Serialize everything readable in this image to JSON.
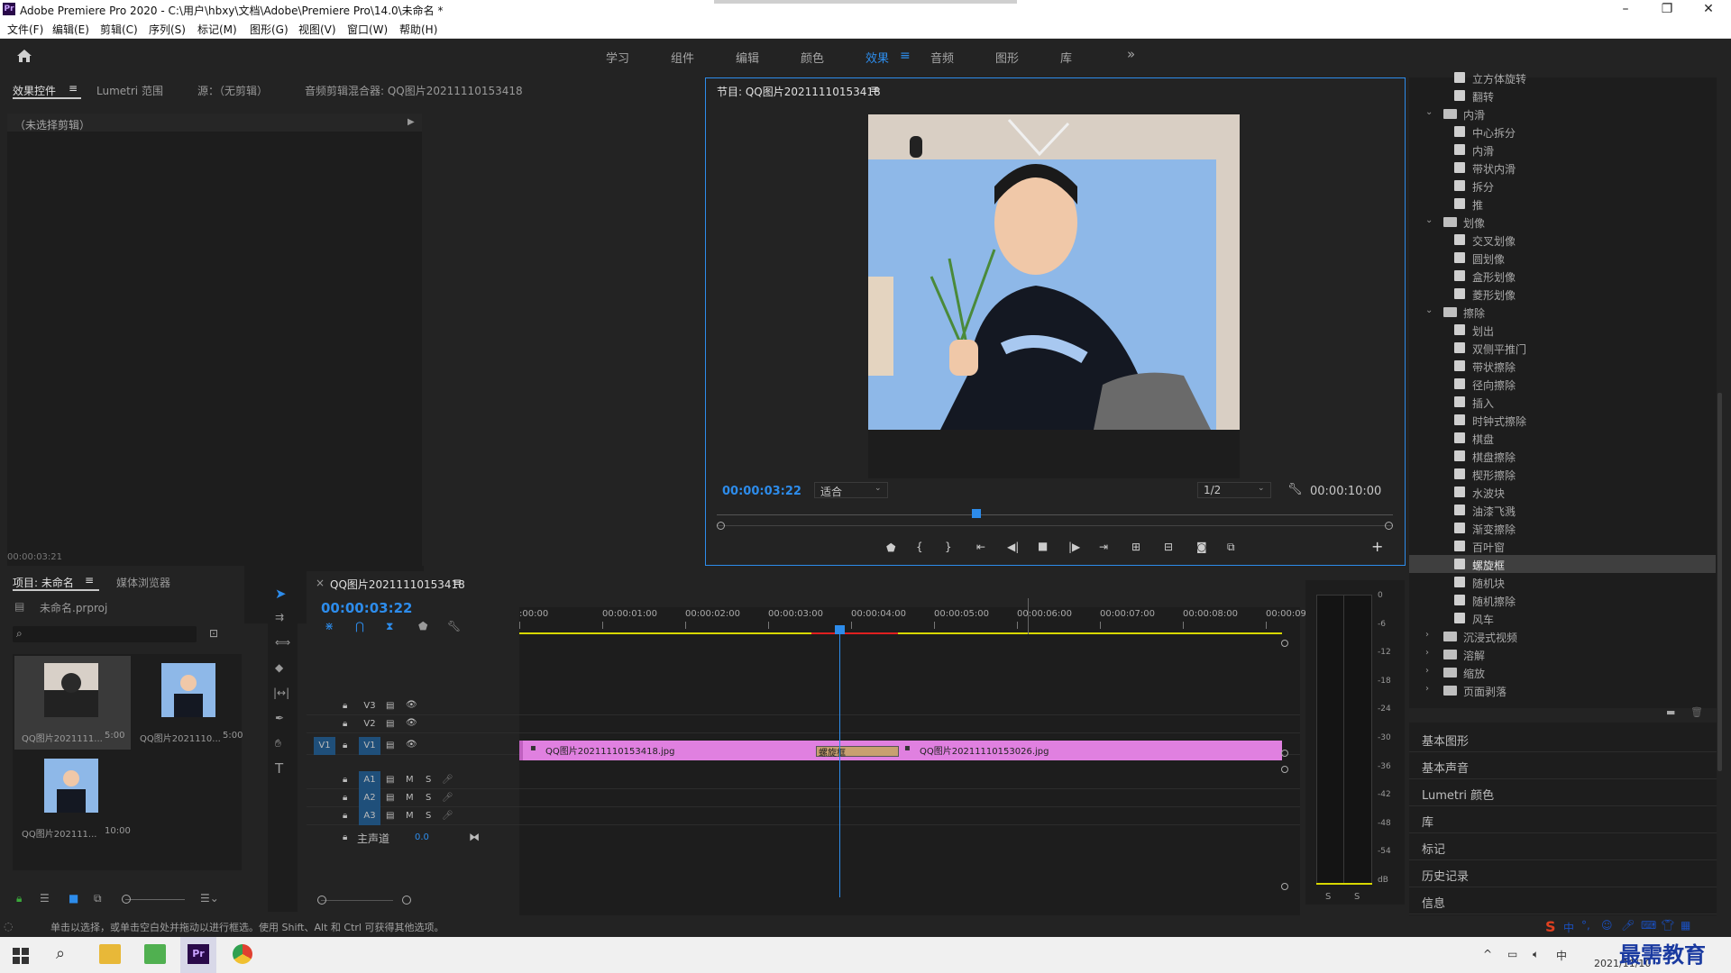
{
  "window": {
    "title": "Adobe Premiere Pro 2020 - C:\\用户\\hbxy\\文档\\Adobe\\Premiere Pro\\14.0\\未命名 *",
    "minimize": "–",
    "maximize": "❐",
    "close": "✕"
  },
  "menu": [
    "文件(F)",
    "编辑(E)",
    "剪辑(C)",
    "序列(S)",
    "标记(M)",
    "图形(G)",
    "视图(V)",
    "窗口(W)",
    "帮助(H)"
  ],
  "workspaces": [
    "学习",
    "组件",
    "编辑",
    "颜色",
    "效果",
    "音频",
    "图形",
    "库"
  ],
  "workspace_active": "效果",
  "workspace_more": "»",
  "source_panel": {
    "tabs": [
      "效果控件",
      "Lumetri 范围",
      "源：（无剪辑）",
      "音频剪辑混合器: QQ图片20211110153418"
    ],
    "no_clip": "（未选择剪辑）",
    "timecode": "00:00:03:21"
  },
  "program": {
    "tab": "节目: QQ图片20211110153418",
    "timecode": "00:00:03:22",
    "fit": "适合",
    "resolution": "1/2",
    "duration": "00:00:10:00"
  },
  "project": {
    "tabs": [
      "项目: 未命名",
      "媒体浏览器"
    ],
    "file": "未命名.prproj",
    "search_placeholder": "",
    "items": [
      {
        "name": "QQ图片2021111...",
        "dur": "5:00"
      },
      {
        "name": "QQ图片2021110...",
        "dur": "5:00"
      },
      {
        "name": "QQ图片202111...",
        "dur": "10:00"
      }
    ]
  },
  "timeline": {
    "tab": "QQ图片20211110153418",
    "timecode": "00:00:03:22",
    "ruler": [
      ":00:00",
      "00:00:01:00",
      "00:00:02:00",
      "00:00:03:00",
      "00:00:04:00",
      "00:00:05:00",
      "00:00:06:00",
      "00:00:07:00",
      "00:00:08:00",
      "00:00:09:"
    ],
    "video_tracks": [
      "V3",
      "V2",
      "V1"
    ],
    "audio_tracks": [
      "A1",
      "A2",
      "A3"
    ],
    "master": "主声道",
    "master_val": "0.0",
    "src_v1": "V1",
    "clip1": "QQ图片20211110153418.jpg",
    "clip2": "QQ图片20211110153026.jpg",
    "transition": "螺旋框",
    "m": "M",
    "s": "S"
  },
  "meter": {
    "ticks": [
      "0",
      "-6",
      "-12",
      "-18",
      "-24",
      "-30",
      "-36",
      "-42",
      "-48",
      "-54",
      "dB"
    ],
    "solo": [
      "S",
      "S"
    ]
  },
  "effects_tree": [
    {
      "type": "item",
      "label": "立方体旋转",
      "partial": true
    },
    {
      "type": "item",
      "label": "翻转"
    },
    {
      "type": "folder",
      "label": "内滑",
      "open": true
    },
    {
      "type": "item",
      "label": "中心拆分"
    },
    {
      "type": "item",
      "label": "内滑"
    },
    {
      "type": "item",
      "label": "带状内滑"
    },
    {
      "type": "item",
      "label": "拆分"
    },
    {
      "type": "item",
      "label": "推"
    },
    {
      "type": "folder",
      "label": "划像",
      "open": true
    },
    {
      "type": "item",
      "label": "交叉划像"
    },
    {
      "type": "item",
      "label": "圆划像"
    },
    {
      "type": "item",
      "label": "盒形划像"
    },
    {
      "type": "item",
      "label": "菱形划像"
    },
    {
      "type": "folder",
      "label": "擦除",
      "open": true
    },
    {
      "type": "item",
      "label": "划出"
    },
    {
      "type": "item",
      "label": "双侧平推门"
    },
    {
      "type": "item",
      "label": "带状擦除"
    },
    {
      "type": "item",
      "label": "径向擦除"
    },
    {
      "type": "item",
      "label": "插入"
    },
    {
      "type": "item",
      "label": "时钟式擦除"
    },
    {
      "type": "item",
      "label": "棋盘"
    },
    {
      "type": "item",
      "label": "棋盘擦除"
    },
    {
      "type": "item",
      "label": "楔形擦除"
    },
    {
      "type": "item",
      "label": "水波块"
    },
    {
      "type": "item",
      "label": "油漆飞溅"
    },
    {
      "type": "item",
      "label": "渐变擦除"
    },
    {
      "type": "item",
      "label": "百叶窗"
    },
    {
      "type": "item",
      "label": "螺旋框",
      "selected": true
    },
    {
      "type": "item",
      "label": "随机块"
    },
    {
      "type": "item",
      "label": "随机擦除"
    },
    {
      "type": "item",
      "label": "风车"
    },
    {
      "type": "folder",
      "label": "沉浸式视频",
      "open": false
    },
    {
      "type": "folder",
      "label": "溶解",
      "open": false
    },
    {
      "type": "folder",
      "label": "缩放",
      "open": false
    },
    {
      "type": "folder",
      "label": "页面剥落",
      "open": false
    }
  ],
  "side_panels": [
    "基本图形",
    "基本声音",
    "Lumetri 颜色",
    "库",
    "标记",
    "历史记录",
    "信息"
  ],
  "status": "单击以选择，或单击空白处并拖动以进行框选。使用 Shift、Alt 和 Ctrl 可获得其他选项。",
  "taskbar": {
    "date": "2021/11/10",
    "ime": "中",
    "watermark": "最需教育"
  },
  "colors": {
    "accent": "#2d8ceb",
    "clip": "#e080e0",
    "playhead": "#2d8ceb",
    "selected_row": "#3f3f3f"
  }
}
